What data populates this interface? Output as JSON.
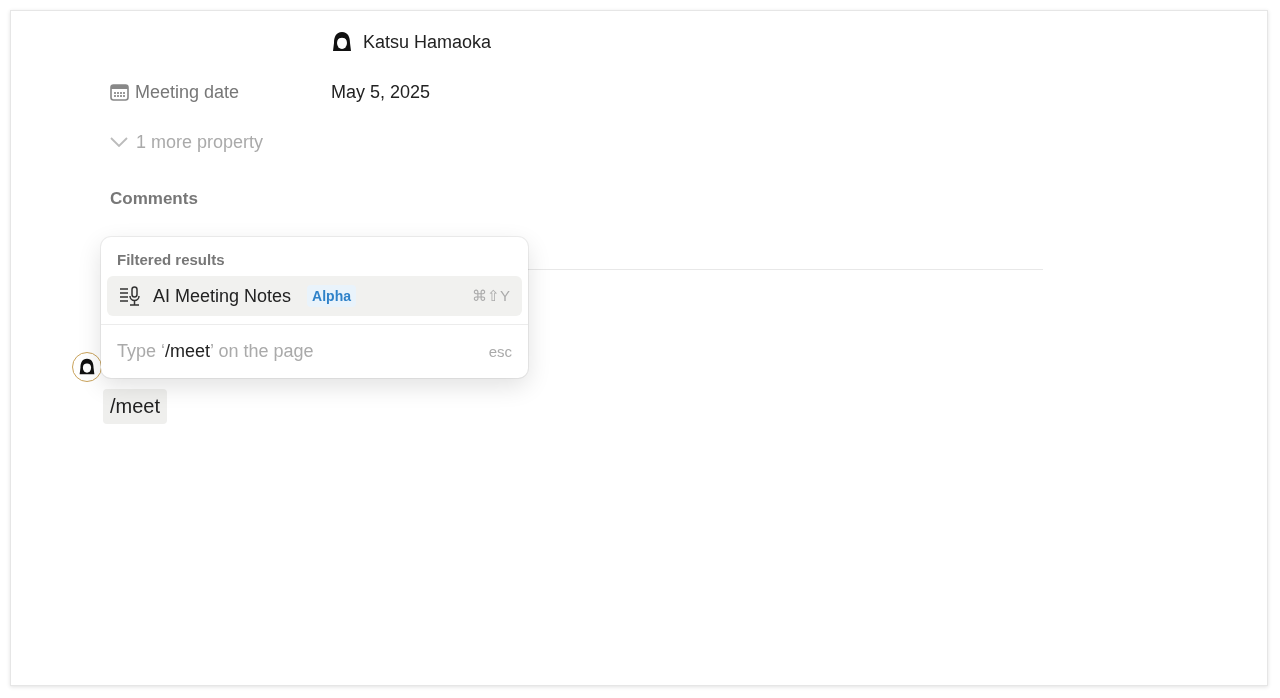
{
  "properties": [
    {
      "kind": "person",
      "value": "Katsu Hamaoka"
    },
    {
      "kind": "date",
      "label": "Meeting date",
      "value": "May 5, 2025"
    }
  ],
  "more_properties": {
    "label": "1 more property",
    "expanded": false
  },
  "comments": {
    "title": "Comments"
  },
  "block": {
    "text": "/meet"
  },
  "menu": {
    "header": "Filtered results",
    "items": [
      {
        "label": "AI Meeting Notes",
        "badge": "Alpha",
        "shortcut": "⌘⇧Y",
        "selected": true
      }
    ],
    "footer": {
      "prefix": "Type ‘",
      "query": "/meet",
      "suffix": "’ on the page",
      "hint": "esc"
    }
  }
}
